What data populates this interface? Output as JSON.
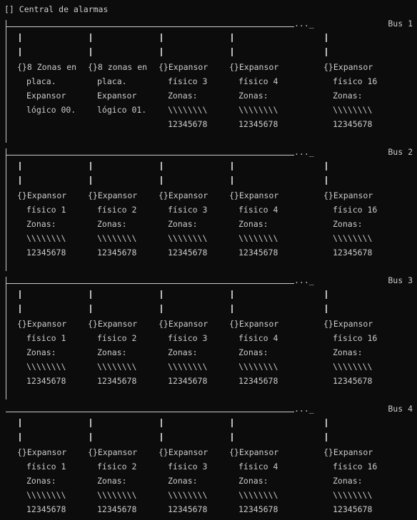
{
  "title": "[] Central de alarmas",
  "zone_label": "Zonas:",
  "zone_bits": "\\\\\\\\\\\\\\\\",
  "zone_numbers": "12345678",
  "line_tail": "..._",
  "buses": [
    {
      "label": "Bus 1",
      "modules": [
        {
          "lines": [
            "{}8 Zonas en",
            "placa.",
            "Expansor",
            "lógico 00."
          ]
        },
        {
          "lines": [
            "{}8 zonas en",
            "placa.",
            "Expansor",
            "lógico 01."
          ]
        },
        {
          "lines": [
            "{}Expansor",
            "físico 3"
          ]
        },
        {
          "lines": [
            "{}Expansor",
            "físico 4"
          ]
        },
        {
          "lines": [
            "{}Expansor",
            "físico 16"
          ]
        }
      ]
    },
    {
      "label": "Bus 2",
      "modules": [
        {
          "lines": [
            "{}Expansor",
            "físico 1"
          ]
        },
        {
          "lines": [
            "{}Expansor",
            "físico 2"
          ]
        },
        {
          "lines": [
            "{}Expansor",
            "físico 3"
          ]
        },
        {
          "lines": [
            "{}Expansor",
            "físico 4"
          ]
        },
        {
          "lines": [
            "{}Expansor",
            "físico 16"
          ]
        }
      ]
    },
    {
      "label": "Bus 3",
      "modules": [
        {
          "lines": [
            "{}Expansor",
            "físico 1"
          ]
        },
        {
          "lines": [
            "{}Expansor",
            "físico 2"
          ]
        },
        {
          "lines": [
            "{}Expansor",
            "físico 3"
          ]
        },
        {
          "lines": [
            "{}Expansor",
            "físico 4"
          ]
        },
        {
          "lines": [
            "{}Expansor",
            "físico 16"
          ]
        }
      ]
    },
    {
      "label": "Bus 4",
      "modules": [
        {
          "lines": [
            "{}Expansor",
            "físico 1"
          ]
        },
        {
          "lines": [
            "{}Expansor",
            "físico 2"
          ]
        },
        {
          "lines": [
            "{}Expansor",
            "físico 3"
          ]
        },
        {
          "lines": [
            "{}Expansor",
            "físico 4"
          ]
        },
        {
          "lines": [
            "{}Expansor",
            "físico 16"
          ]
        }
      ]
    }
  ]
}
